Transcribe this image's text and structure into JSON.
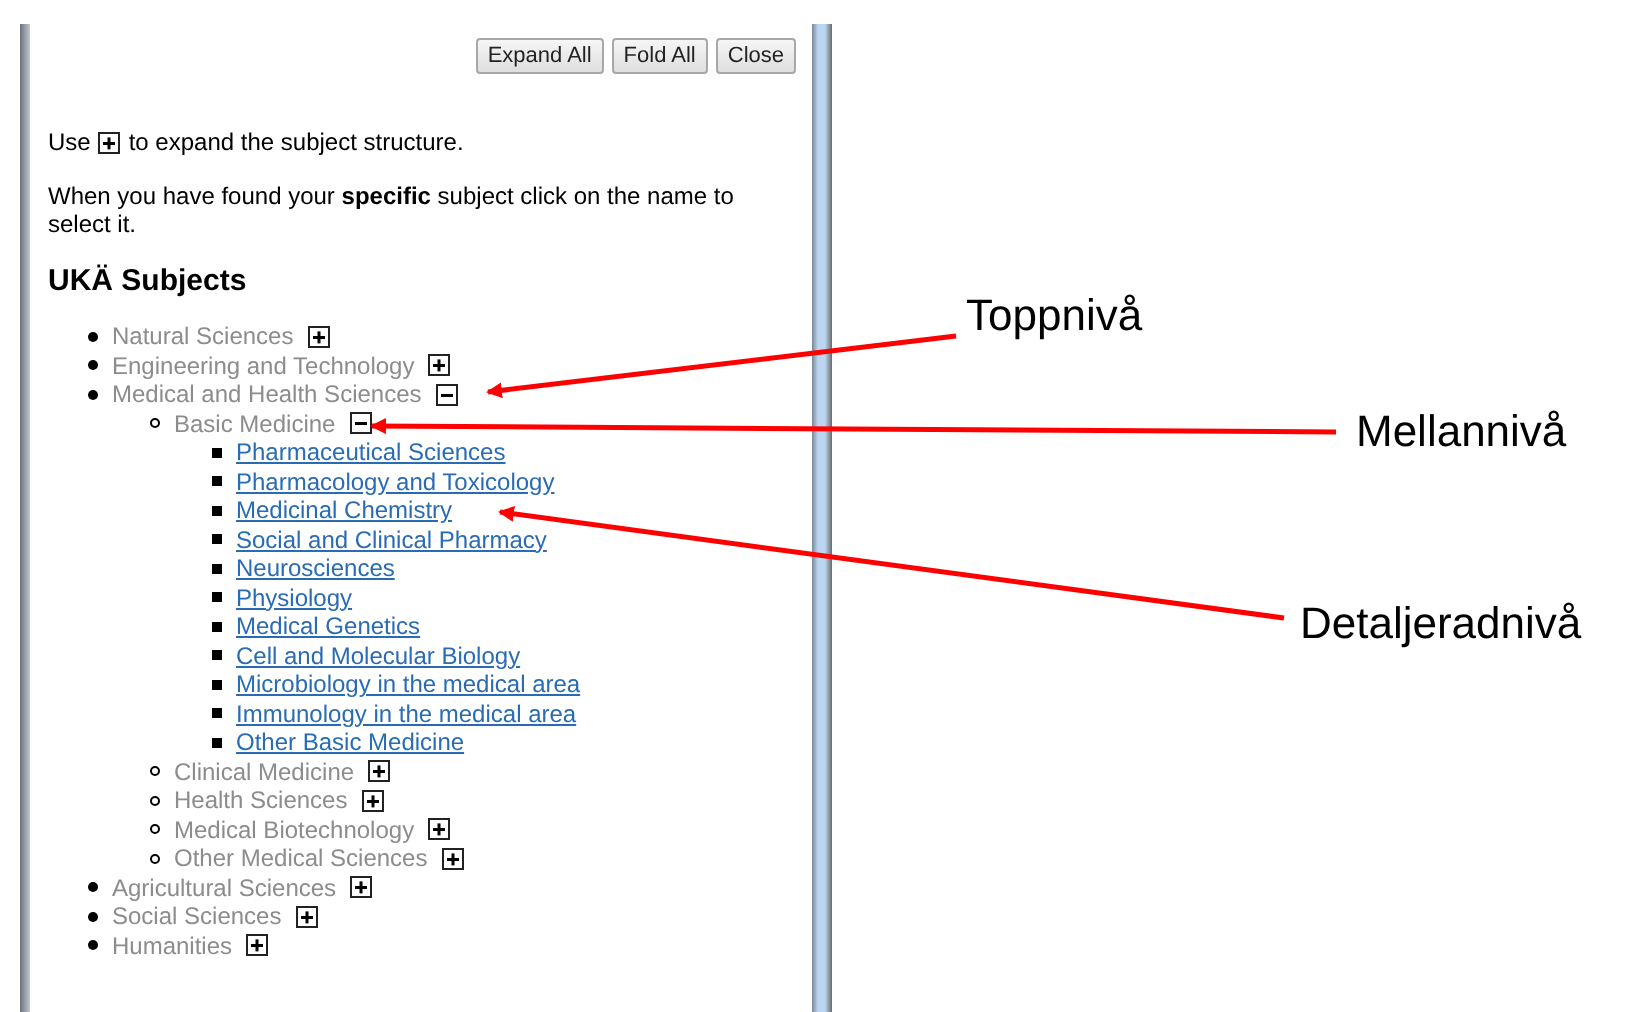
{
  "toolbar": {
    "buttons": [
      "Expand All",
      "Fold All",
      "Close"
    ]
  },
  "intro": {
    "before_icon": "Use",
    "after_icon": "to expand the subject structure."
  },
  "instruction": "When you have found your **specific** subject click on the name to select it.",
  "heading": "UKÄ Subjects",
  "tree": [
    {
      "kind": "category",
      "label": "Natural Sciences",
      "expanded": false
    },
    {
      "kind": "category",
      "label": "Engineering and Technology",
      "expanded": false
    },
    {
      "kind": "category",
      "label": "Medical and Health Sciences",
      "expanded": true,
      "children": [
        {
          "kind": "category",
          "label": "Basic Medicine",
          "expanded": true,
          "children": [
            {
              "kind": "subject",
              "label": "Pharmaceutical Sciences"
            },
            {
              "kind": "subject",
              "label": "Pharmacology and Toxicology"
            },
            {
              "kind": "subject",
              "label": "Medicinal Chemistry"
            },
            {
              "kind": "subject",
              "label": "Social and Clinical Pharmacy"
            },
            {
              "kind": "subject",
              "label": "Neurosciences"
            },
            {
              "kind": "subject",
              "label": "Physiology"
            },
            {
              "kind": "subject",
              "label": "Medical Genetics"
            },
            {
              "kind": "subject",
              "label": "Cell and Molecular Biology"
            },
            {
              "kind": "subject",
              "label": "Microbiology in the medical area"
            },
            {
              "kind": "subject",
              "label": "Immunology in the medical area"
            },
            {
              "kind": "subject",
              "label": "Other Basic Medicine"
            }
          ]
        },
        {
          "kind": "category",
          "label": "Clinical Medicine",
          "expanded": false
        },
        {
          "kind": "category",
          "label": "Health Sciences",
          "expanded": false
        },
        {
          "kind": "category",
          "label": "Medical Biotechnology",
          "expanded": false
        },
        {
          "kind": "category",
          "label": "Other Medical Sciences",
          "expanded": false
        }
      ]
    },
    {
      "kind": "category",
      "label": "Agricultural Sciences",
      "expanded": false
    },
    {
      "kind": "category",
      "label": "Social Sciences",
      "expanded": false
    },
    {
      "kind": "category",
      "label": "Humanities",
      "expanded": false
    }
  ],
  "annotations": [
    {
      "label": "Toppnivå"
    },
    {
      "label": "Mellannivå"
    },
    {
      "label": "Detaljeradnivå"
    }
  ]
}
